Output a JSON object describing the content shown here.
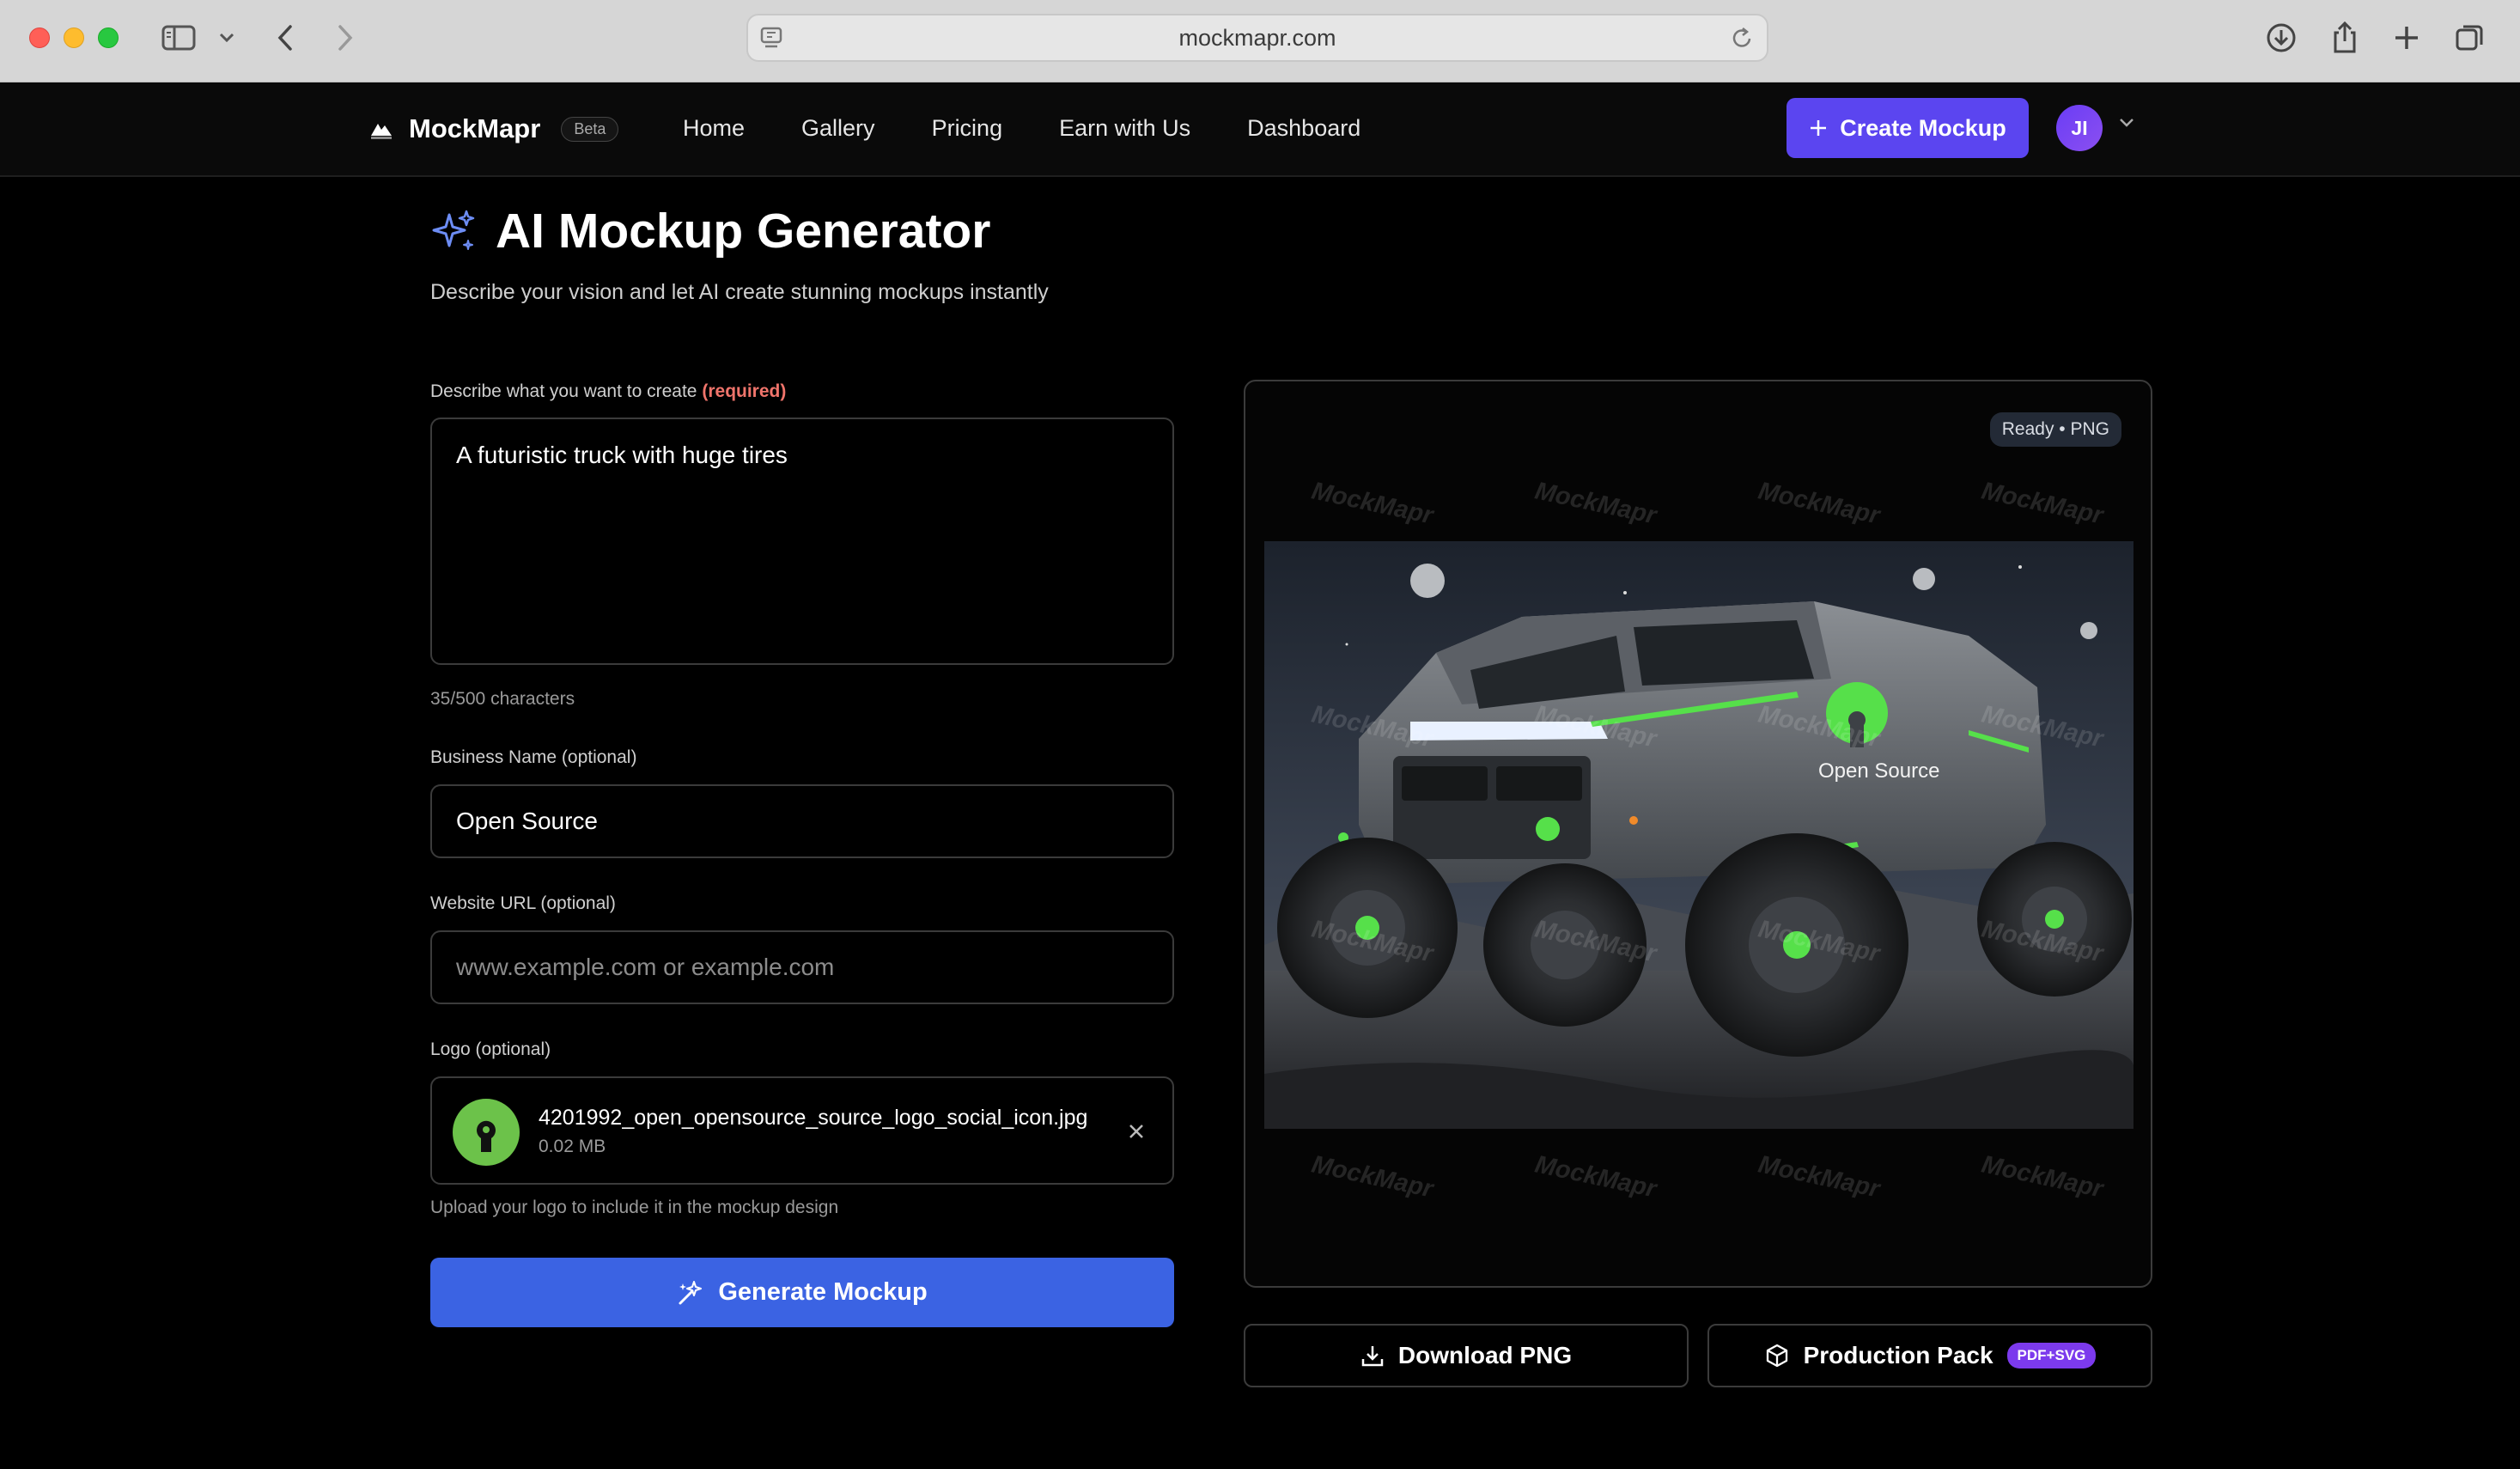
{
  "browser": {
    "url": "mockmapr.com"
  },
  "nav": {
    "brand": "MockMapr",
    "beta": "Beta",
    "links": [
      "Home",
      "Gallery",
      "Pricing",
      "Earn with Us",
      "Dashboard"
    ],
    "create_label": "Create Mockup",
    "avatar_initials": "JI"
  },
  "header": {
    "title": "AI Mockup Generator",
    "subtitle": "Describe your vision and let AI create stunning mockups instantly"
  },
  "form": {
    "prompt_label": "Describe what you want to create",
    "prompt_required": "(required)",
    "prompt_value": "A futuristic truck with huge tires",
    "char_count": "35/500 characters",
    "business_label": "Business Name (optional)",
    "business_value": "Open Source",
    "website_label": "Website URL (optional)",
    "website_placeholder": "www.example.com or example.com",
    "logo_label": "Logo (optional)",
    "logo_filename": "4201992_open_opensource_source_logo_social_icon.jpg",
    "logo_size": "0.02 MB",
    "logo_hint": "Upload your logo to include it in the mockup design",
    "generate_label": "Generate Mockup"
  },
  "preview": {
    "status": "Ready • PNG",
    "watermark": "MockMapr",
    "vehicle_text": "Open Source"
  },
  "actions": {
    "download_label": "Download PNG",
    "production_label": "Production Pack",
    "production_badge": "PDF+SVG"
  },
  "colors": {
    "accent": "#5b45f0",
    "generate": "#3b63e3",
    "badge": "#7c3aed",
    "brand_green": "#6cc24a"
  }
}
